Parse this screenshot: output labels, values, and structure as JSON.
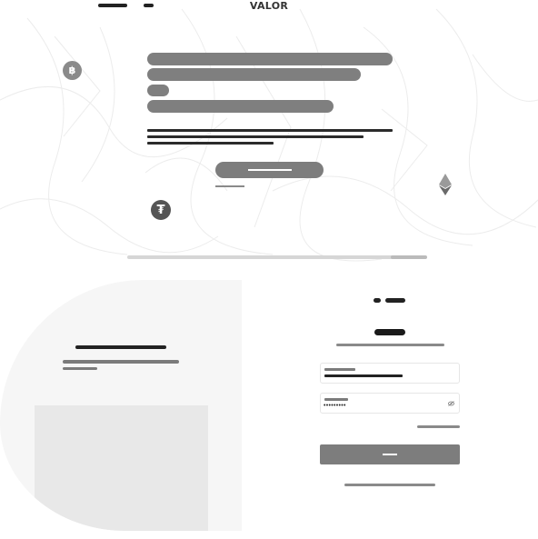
{
  "header": {
    "brand_name": "VALOR"
  },
  "hero": {
    "coins": {
      "bitcoin": {
        "icon": "bitcoin-icon",
        "glyph": "฿"
      },
      "tether": {
        "icon": "tether-icon",
        "glyph": "₮"
      },
      "ethereum": {
        "icon": "ethereum-icon"
      }
    }
  },
  "login": {
    "password_mask": "•••••••••",
    "password_toggle_icon": "eye-off-icon"
  },
  "colors": {
    "primary_button": "#7d7d7d",
    "dark_text": "#222222",
    "muted_text": "#8a8a8a",
    "panel_background": "#f6f6f6",
    "image_placeholder": "#e8e8e8"
  }
}
